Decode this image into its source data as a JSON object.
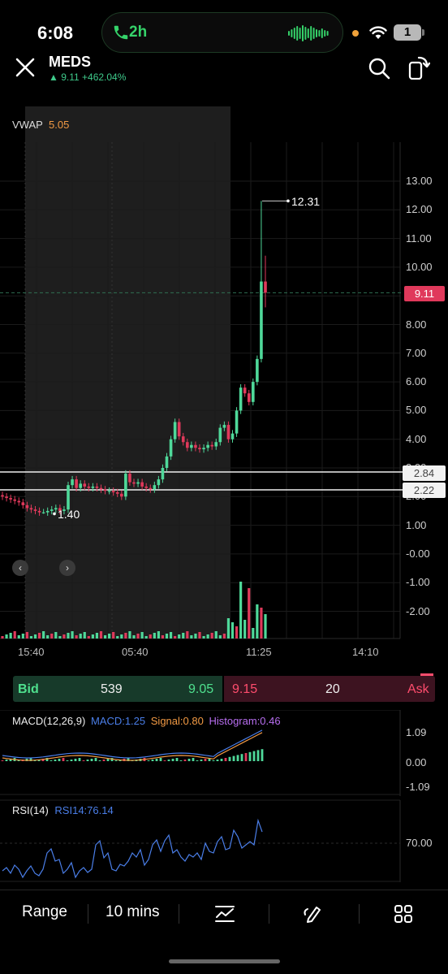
{
  "status_bar": {
    "time": "6:08",
    "call_duration": "2h",
    "battery": "1"
  },
  "header": {
    "ticker": "MEDS",
    "quote": "▲ 9.11 +462.04%"
  },
  "chart": {
    "vwap_label": "VWAP",
    "vwap_value": "5.05",
    "y_ticks": [
      "13.00",
      "12.00",
      "11.00",
      "10.00",
      "9.00",
      "8.00",
      "7.00",
      "6.00",
      "5.00",
      "4.00",
      "3.00",
      "2.00",
      "1.00",
      "-0.00",
      "-1.00",
      "-2.00"
    ],
    "x_ticks": [
      "15:40",
      "05:40",
      "11:25",
      "14:10"
    ],
    "last_price_tag": "9.11",
    "range_high_tag": "2.84",
    "range_low_tag": "2.22",
    "high_callout": "12.31",
    "low_callout": "1.40",
    "nav_prev": "‹",
    "nav_next": "›"
  },
  "chart_data": {
    "type": "candlestick",
    "ylim": [
      -2.6,
      13.6
    ],
    "overlays": {
      "vwap": 5.05,
      "last": 9.11,
      "high": 12.31,
      "low": 1.4,
      "level_lines": [
        2.84,
        2.22
      ]
    },
    "close_path": [
      2.0,
      1.95,
      1.9,
      1.85,
      1.8,
      1.7,
      1.6,
      1.55,
      1.5,
      1.45,
      1.45,
      1.5,
      1.55,
      1.6,
      1.5,
      1.55,
      2.4,
      2.6,
      2.3,
      2.45,
      2.35,
      2.3,
      2.35,
      2.3,
      2.25,
      2.2,
      2.2,
      2.15,
      2.1,
      2.0,
      2.8,
      2.5,
      2.45,
      2.5,
      2.35,
      2.3,
      2.25,
      2.4,
      2.6,
      3.0,
      3.4,
      4.0,
      4.6,
      4.1,
      3.9,
      3.7,
      3.8,
      3.7,
      3.65,
      3.7,
      3.8,
      3.75,
      3.9,
      4.4,
      4.5,
      4.0,
      4.2,
      5.0,
      5.8,
      5.6,
      5.3,
      6.0,
      6.8,
      9.5,
      9.11
    ]
  },
  "bidask": {
    "bid_label": "Bid",
    "bid_size": "539",
    "bid_price": "9.05",
    "ask_price": "9.15",
    "ask_size": "20",
    "ask_label": "Ask"
  },
  "macd": {
    "title": "MACD(12,26,9)",
    "macd": "MACD:1.25",
    "signal": "Signal:0.80",
    "histogram": "Histogram:0.46",
    "ticks": [
      "1.09",
      "0.00",
      "-1.09"
    ],
    "colors": {
      "macd": "#4a7ee8",
      "signal": "#f29a44",
      "histogram": "#b86ef0"
    }
  },
  "rsi": {
    "title": "RSI(14)",
    "value": "RSI14:76.14",
    "ticks": [
      "70.00"
    ]
  },
  "toolbar": {
    "range": "Range",
    "interval": "10 mins"
  }
}
